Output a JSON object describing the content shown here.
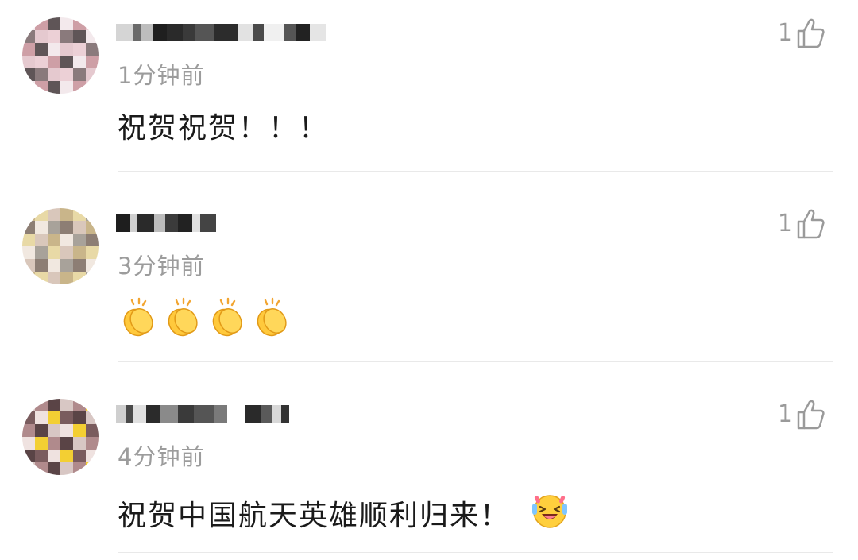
{
  "comments": [
    {
      "time": "1分钟前",
      "like_count": "1",
      "content": "祝贺祝贺！！！",
      "avatar_palette": [
        "#f3e9ec",
        "#8a7a7c",
        "#ce9fa6",
        "#e5c9cf",
        "#5f5557",
        "#ecd0d6"
      ]
    },
    {
      "time": "3分钟前",
      "like_count": "1",
      "content": "",
      "reactions": [
        "clapping-hands",
        "clapping-hands",
        "clapping-hands",
        "clapping-hands"
      ],
      "avatar_palette": [
        "#f1e8e0",
        "#d9c7bb",
        "#a8a29a",
        "#c9b58a",
        "#8d7e74",
        "#e8d9a6"
      ]
    },
    {
      "time": "4分钟前",
      "like_count": "1",
      "content": "祝贺中国航天英雄顺利归来！",
      "trailing_emoji": "laughing-face",
      "avatar_palette": [
        "#d8c7c4",
        "#7a5c5e",
        "#b08a8c",
        "#efe2e0",
        "#5a4446",
        "#f3cf33"
      ]
    }
  ],
  "colors": {
    "text_primary": "#1a1a1a",
    "text_secondary": "#9c9c9c",
    "divider": "#e9e9e9"
  }
}
